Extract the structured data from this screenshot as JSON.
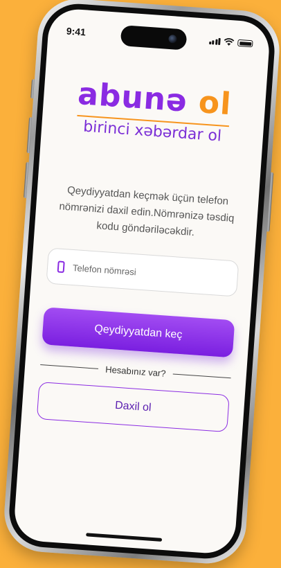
{
  "colors": {
    "background": "#FBB03B",
    "brand_purple": "#8A2BE2",
    "brand_orange": "#F7941D"
  },
  "status_bar": {
    "time": "9:41",
    "icons": [
      "signal-icon",
      "wifi-icon",
      "battery-icon"
    ]
  },
  "logo": {
    "word": "abunə",
    "accent": "ol",
    "tagline": "birinci xəbərdar ol"
  },
  "intro_text": "Qeydiyyatdan keçmək üçün telefon nömrənizi daxil edin.Nömrənizə təsdiq kodu göndəriləcəkdir.",
  "phone_field": {
    "placeholder": "Telefon nömrəsi",
    "value": "",
    "icon": "phone-icon"
  },
  "register_button": "Qeydiyyatdan keç",
  "divider_text": "Hesabınız var?",
  "login_button": "Daxil ol"
}
